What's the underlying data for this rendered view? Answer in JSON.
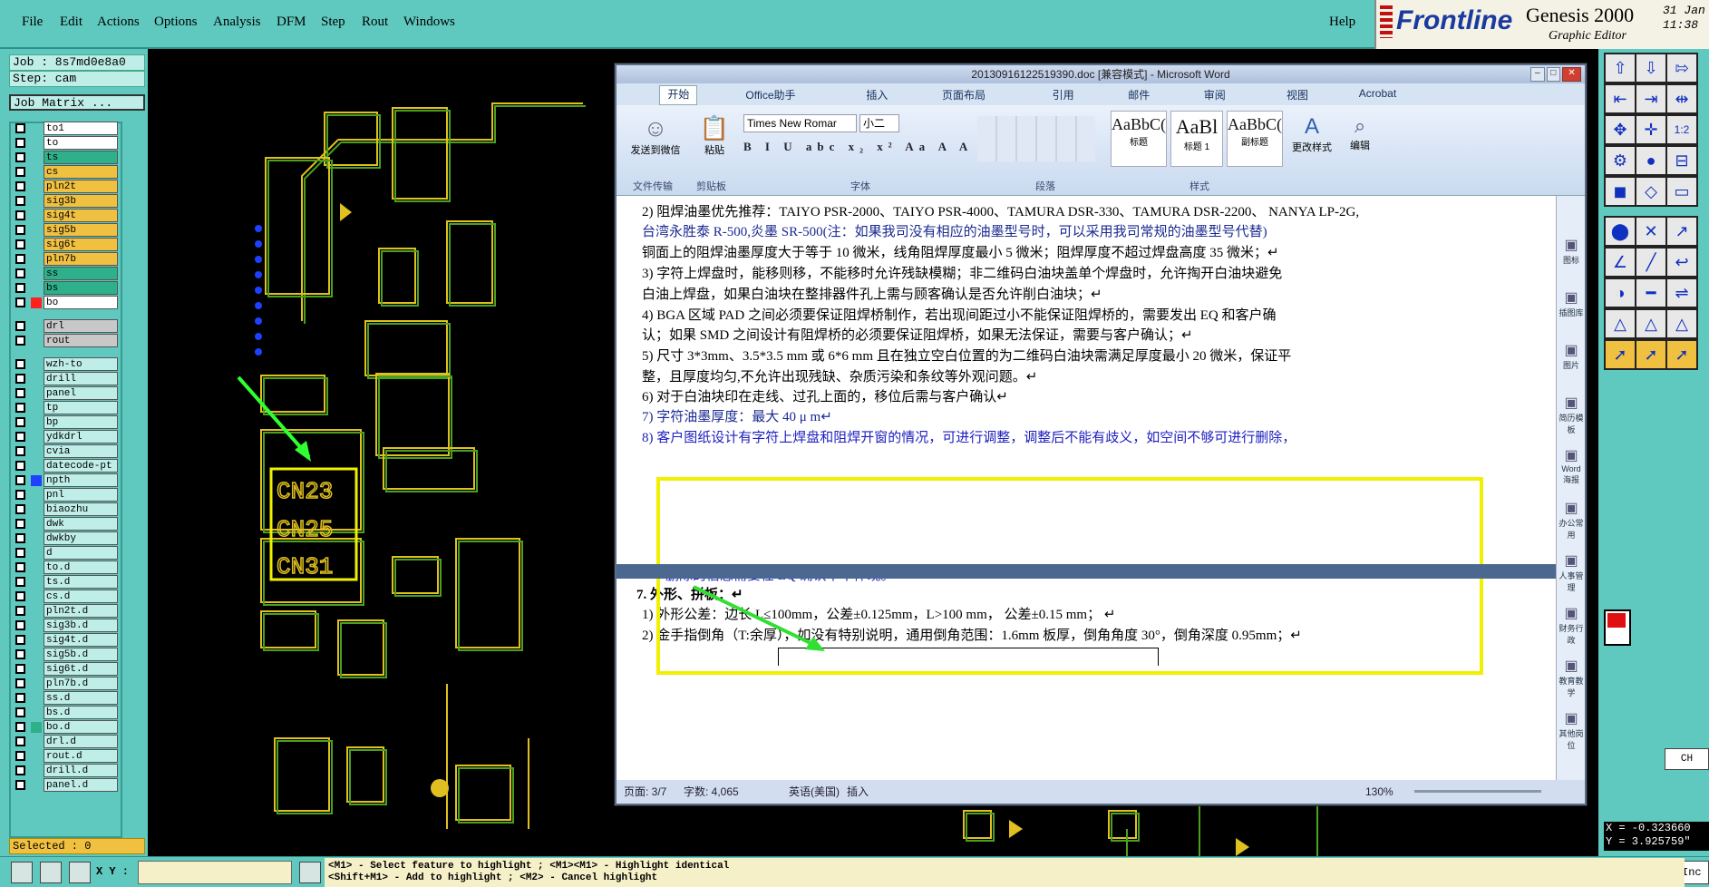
{
  "menu": [
    "File",
    "Edit",
    "Actions",
    "Options",
    "Analysis",
    "DFM",
    "Step",
    "Rout",
    "Windows"
  ],
  "help": "Help",
  "logo": {
    "brand": "Frontline",
    "product": "Genesis 2000",
    "date_line1": "31 Jan",
    "date_line2": "11:38",
    "subtitle": "Graphic Editor"
  },
  "job": "Job : 8s7md0e8a0",
  "step": "Step: cam",
  "matrix_btn": "Job Matrix ...",
  "layers": [
    {
      "name": "to1",
      "c": "#ffffff"
    },
    {
      "name": "to",
      "c": "#ffffff"
    },
    {
      "name": "ts",
      "c": "#2eb08a"
    },
    {
      "name": "cs",
      "c": "#f0c040"
    },
    {
      "name": "pln2t",
      "c": "#f0c040"
    },
    {
      "name": "sig3b",
      "c": "#f0c040"
    },
    {
      "name": "sig4t",
      "c": "#f0c040"
    },
    {
      "name": "sig5b",
      "c": "#f0c040"
    },
    {
      "name": "sig6t",
      "c": "#f0c040"
    },
    {
      "name": "pln7b",
      "c": "#f0c040"
    },
    {
      "name": "ss",
      "c": "#2eb08a"
    },
    {
      "name": "bs",
      "c": "#2eb08a"
    },
    {
      "name": "bo",
      "c": "#ffffff",
      "mark": "#ff2020"
    },
    {
      "name": "drl",
      "c": "#c8c8c8",
      "gap": true
    },
    {
      "name": "rout",
      "c": "#c8c8c8"
    },
    {
      "name": "wzh-to",
      "c": "#bfeee8",
      "gap": true
    },
    {
      "name": "drill",
      "c": "#bfeee8"
    },
    {
      "name": "panel",
      "c": "#bfeee8"
    },
    {
      "name": "tp",
      "c": "#bfeee8"
    },
    {
      "name": "bp",
      "c": "#bfeee8"
    },
    {
      "name": "ydkdrl",
      "c": "#bfeee8"
    },
    {
      "name": "cvia",
      "c": "#bfeee8"
    },
    {
      "name": "datecode-pt",
      "c": "#bfeee8"
    },
    {
      "name": "npth",
      "c": "#bfeee8",
      "mark": "#2040ff"
    },
    {
      "name": "pnl",
      "c": "#bfeee8"
    },
    {
      "name": "biaozhu",
      "c": "#bfeee8"
    },
    {
      "name": "dwk",
      "c": "#bfeee8"
    },
    {
      "name": "dwkby",
      "c": "#bfeee8"
    },
    {
      "name": "d",
      "c": "#bfeee8"
    },
    {
      "name": "to.d",
      "c": "#bfeee8"
    },
    {
      "name": "ts.d",
      "c": "#bfeee8"
    },
    {
      "name": "cs.d",
      "c": "#bfeee8"
    },
    {
      "name": "pln2t.d",
      "c": "#bfeee8"
    },
    {
      "name": "sig3b.d",
      "c": "#bfeee8"
    },
    {
      "name": "sig4t.d",
      "c": "#bfeee8"
    },
    {
      "name": "sig5b.d",
      "c": "#bfeee8"
    },
    {
      "name": "sig6t.d",
      "c": "#bfeee8"
    },
    {
      "name": "pln7b.d",
      "c": "#bfeee8"
    },
    {
      "name": "ss.d",
      "c": "#bfeee8"
    },
    {
      "name": "bs.d",
      "c": "#bfeee8"
    },
    {
      "name": "bo.d",
      "c": "#bfeee8",
      "mark": "#2eb08a"
    },
    {
      "name": "drl.d",
      "c": "#bfeee8"
    },
    {
      "name": "rout.d",
      "c": "#bfeee8"
    },
    {
      "name": "drill.d",
      "c": "#bfeee8"
    },
    {
      "name": "panel.d",
      "c": "#bfeee8"
    }
  ],
  "selected": "Selected : 0",
  "xy_label": "X Y :",
  "hint1": "<M1> - Select feature to highlight ; <M1><M1> - Highlight identical",
  "hint2": "<Shift+M1> - Add to highlight ; <M2> - Cancel highlight",
  "coord_x": "X = -0.323660",
  "coord_y": "Y = 3.925759\"",
  "ch": "CH",
  "inc": "Inc",
  "word": {
    "title": "20130916122519390.doc [兼容模式] - Microsoft Word",
    "tabs": [
      "开始",
      "Office助手",
      "插入",
      "页面布局",
      "引用",
      "邮件",
      "审阅",
      "视图",
      "Acrobat"
    ],
    "groups": [
      "文件传输",
      "剪贴板",
      "字体",
      "段落",
      "样式",
      "编辑"
    ],
    "send": "发送到微信",
    "paste": "粘贴",
    "font": "Times New Romar",
    "size": "小二",
    "styles": [
      {
        "sample": "AaBbC(",
        "name": "标题"
      },
      {
        "sample": "AaBl",
        "name": "标题 1"
      },
      {
        "sample": "AaBbC(",
        "name": "副标题"
      }
    ],
    "change_style": "更改样式",
    "edit": "编辑",
    "lines": [
      {
        "t": "2)  阻焊油墨优先推荐：TAIYO PSR-2000、TAIYO PSR-4000、TAMURA   DSR-330、TAMURA DSR-2200、 NANYA LP-2G,",
        "c": "#000"
      },
      {
        "t": "     台湾永胜泰 R-500,炎墨 SR-500(注：如果我司没有相应的油墨型号时，可以采用我司常规的油墨型号代替)",
        "c": "#1a2a90"
      },
      {
        "t": "     铜面上的阻焊油墨厚度大于等于 10 微米，线角阻焊厚度最小 5 微米；阻焊厚度不超过焊盘高度 35 微米；↵",
        "c": "#000"
      },
      {
        "t": "3)  字符上焊盘时，能移则移，不能移时允许残缺模糊；非二维码白油块盖单个焊盘时，允许掏开白油块避免",
        "c": "#000"
      },
      {
        "t": "     白油上焊盘，如果白油块在整排器件孔上需与顾客确认是否允许削白油块；↵",
        "c": "#000"
      },
      {
        "t": "4)  BGA 区域 PAD 之间必须要保证阻焊桥制作，若出现间距过小不能保证阻焊桥的，需要发出 EQ 和客户确",
        "c": "#000"
      },
      {
        "t": "     认；如果 SMD 之间设计有阻焊桥的必须要保证阻焊桥，如果无法保证，需要与客户确认；↵",
        "c": "#000"
      },
      {
        "t": "5)  尺寸 3*3mm、3.5*3.5 mm 或 6*6 mm 且在独立空白位置的为二维码白油块需满足厚度最小 20 微米，保证平",
        "c": "#000"
      },
      {
        "t": "     整，且厚度均匀,不允许出现残缺、杂质污染和条纹等外观问题。↵",
        "c": "#000"
      },
      {
        "t": "6)  对于白油块印在走线、过孔上面的，移位后需与客户确认↵",
        "c": "#000"
      },
      {
        "t": "7)  字符油墨厚度：最大 40 μ m↵",
        "c": "#1a2a90"
      },
      {
        "t": "8) 客户图纸设计有字符上焊盘和阻焊开窗的情况，可进行调整，调整后不能有歧义，如空间不够可进行删除，",
        "c": "#2020c0"
      },
      {
        "t": "删除的信息需要在 EQ 确认单中体现。↵",
        "c": "#2020c0"
      },
      {
        "t": "7.   外形、拼板：↵",
        "c": "#000"
      },
      {
        "t": "1)  外形公差：边长 L≤100mm，公差±0.125mm，L>100  mm， 公差±0.15  mm；   ↵",
        "c": "#000"
      },
      {
        "t": "2)  金手指倒角（T:余厚），如没有特别说明，通用倒角范围：1.6mm 板厚，倒角角度 30°，倒角深度 0.95mm；↵",
        "c": "#000"
      }
    ],
    "side": [
      "图标",
      "插图库",
      "图片",
      "简历模板",
      "Word海报",
      "办公常用",
      "人事管理",
      "财务行政",
      "教育教学",
      "其他岗位"
    ],
    "status": {
      "page": "页面: 3/7",
      "words": "字数: 4,065",
      "lang": "英语(美国)",
      "mode": "插入",
      "zoom": "130%"
    }
  },
  "pcb_labels": [
    "CN23",
    "CN25",
    "CN31"
  ]
}
